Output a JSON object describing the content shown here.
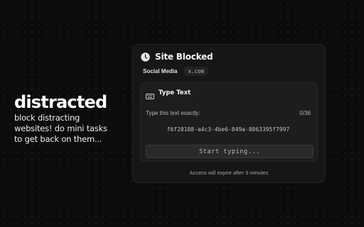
{
  "promo": {
    "title": "distracted",
    "tagline_lines": [
      "block distracting",
      "websites! do mini tasks",
      "to get back on them..."
    ]
  },
  "panel": {
    "title": "Site Blocked",
    "icon": "clock-icon",
    "category": "Social Media",
    "domain": "x.com",
    "task": {
      "icon": "keyboard-icon",
      "title": "Type Text",
      "instruction": "Type this text exactly:",
      "progress": "0/36",
      "target": "f6f28108-a4c3-4be6-849a-8063395f7997",
      "input_value": "",
      "input_placeholder": "Start typing..."
    },
    "expiry": "Access will expire after 3 minutes"
  },
  "colors": {
    "background": "#0c0c0c",
    "panel": "#161616",
    "card": "#1d1d1d",
    "input": "#2a2a2a",
    "text": "#f2f2f2"
  }
}
